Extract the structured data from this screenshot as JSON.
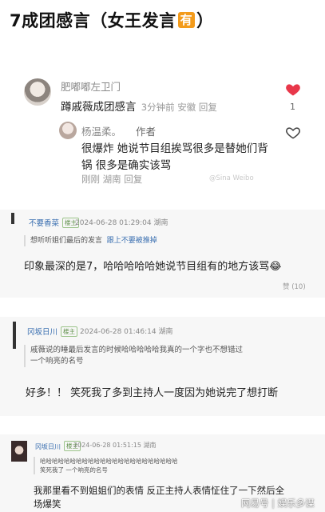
{
  "title": {
    "text": "7成团感言（女王发言",
    "badge": "有",
    "suffix": "）"
  },
  "card1": {
    "user": "肥嘟嘟左卫门",
    "comment": "蹲戚薇成团感言",
    "meta": "3分钟前 安徽 回复",
    "like_count": "1",
    "reply": {
      "user": "杨温柔。",
      "author_label": "作者",
      "text": "很爆炸 她说节目组挨骂很多是替她们背锅 很多是确实该骂",
      "meta": "刚刚 湖南 回复"
    },
    "watermark": "@Sina Weibo"
  },
  "panel1": {
    "user": "不要香菜",
    "tag": "楼主",
    "time": "2024-06-28 01:29:04 湖南",
    "quote_user": "想听听姐们最后的发言",
    "quote_link": "跟上不要被推掉",
    "body": "印象最深的是7，哈哈哈哈哈她说节目组有的地方该骂😂",
    "like": "赞 (10)"
  },
  "panel2": {
    "user": "冈坂日川",
    "tag": "楼主",
    "time": "2024-06-28 01:46:14 湖南",
    "quote_line1": "戚薇说的睡最后发言的时候哈哈哈哈哈我真的一个字也不想错过",
    "quote_line2": "一个响亮的名号",
    "body": "好多！！ 笑死我了多到主持人一度因为她说完了想打断"
  },
  "panel3": {
    "user": "冈坂日川",
    "tag": "楼主",
    "time": "2024-06-28 01:51:15 湖南",
    "quote_line1": "哈哈哈哈哈哈哈哈哈哈哈哈哈哈哈哈哈哈哈哈哈哈哈",
    "quote_line2": "笑死我了   一个响亮的名号",
    "body": "我那里看不到姐姐们的表情 反正主持人表情怔住了一下然后全场爆笑"
  },
  "footer_watermark": "网易号 | 娱乐多谋",
  "colors": {
    "badge": "#f39b1b",
    "heart": "#e8374a",
    "link": "#3a6fb0"
  }
}
